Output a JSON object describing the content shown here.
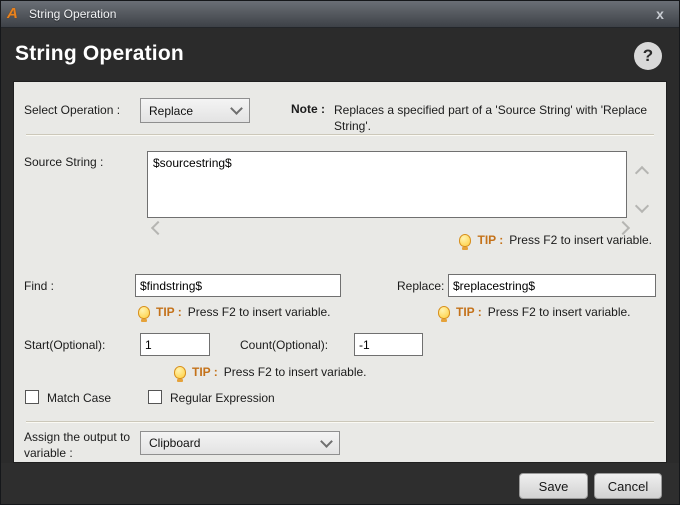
{
  "window": {
    "titlebar": {
      "title": "String Operation",
      "close_glyph": "x"
    },
    "header": {
      "title": "String Operation",
      "help_glyph": "?"
    },
    "logo_glyph": "A"
  },
  "form": {
    "select_operation": {
      "label": "Select Operation :",
      "value": "Replace"
    },
    "note": {
      "label": "Note :",
      "text": "Replaces a specified part of a 'Source String' with 'Replace String'."
    },
    "source_string": {
      "label": "Source String :",
      "value": "$sourcestring$"
    },
    "tip": {
      "label": "TIP :",
      "text": "Press F2 to insert variable."
    },
    "find": {
      "label": "Find :",
      "value": "$findstring$"
    },
    "replace": {
      "label": "Replace:",
      "value": "$replacestring$"
    },
    "start": {
      "label": "Start(Optional):",
      "value": "1"
    },
    "count": {
      "label": "Count(Optional):",
      "value": "-1"
    },
    "match_case": {
      "label": "Match Case",
      "checked": false
    },
    "regular_expression": {
      "label": "Regular Expression",
      "checked": false
    },
    "assign_output": {
      "label": "Assign the output to variable :",
      "value": "Clipboard"
    }
  },
  "footer": {
    "save_label": "Save",
    "cancel_label": "Cancel"
  },
  "colors": {
    "tip_accent": "#c4721a",
    "panel_bg": "#e9e9e6",
    "header_bg": "#2b2b2b",
    "titlebar_top": "#6a6f76",
    "titlebar_bottom": "#3d4147"
  }
}
